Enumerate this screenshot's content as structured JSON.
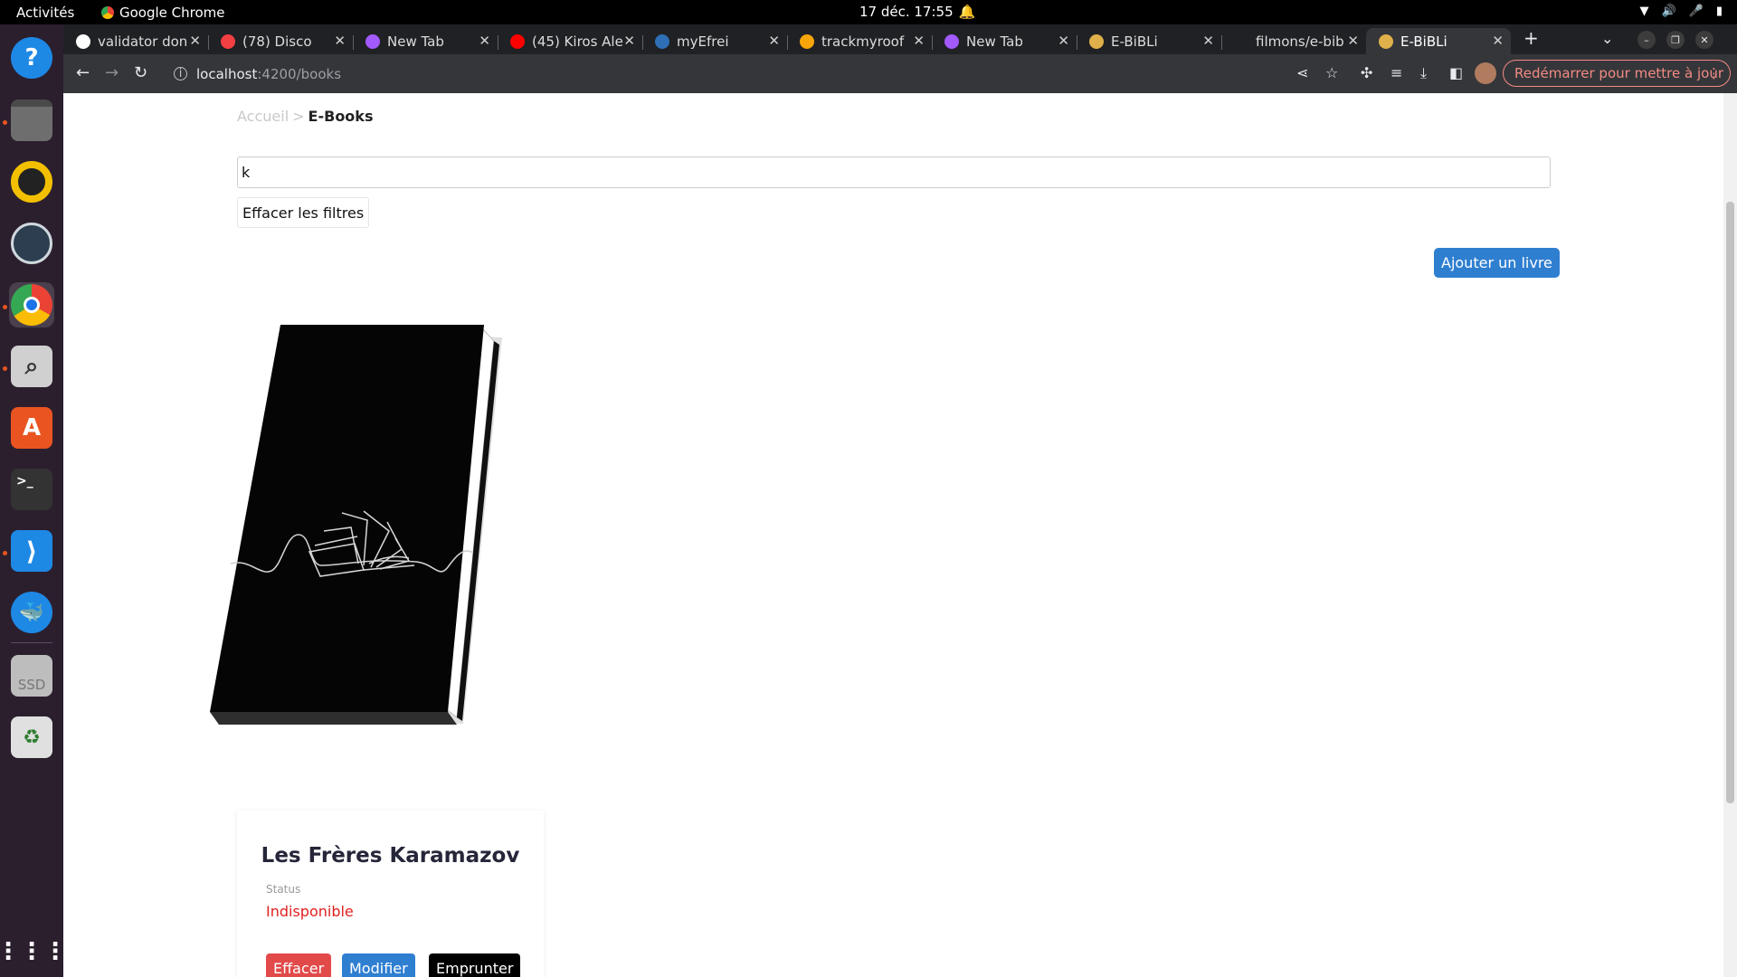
{
  "os": {
    "activities": "Activités",
    "app_name": "Google Chrome",
    "clock": "17 déc.  17:55"
  },
  "dock": {
    "items": [
      "help-icon",
      "files-icon",
      "rhythmbox-icon",
      "stacer-icon",
      "chrome-icon",
      "search-app-icon",
      "app-center-icon",
      "terminal-icon",
      "vscode-icon",
      "docker-icon",
      "ssd-drive-icon",
      "trash-icon",
      "app-grid-icon"
    ],
    "ssd_label": "SSD"
  },
  "browser": {
    "tabs": [
      {
        "title": "validator don",
        "icon": "github-icon",
        "color": "#ffffff"
      },
      {
        "title": "(78) Disco",
        "icon": "discord-icon",
        "color": "#f23f42"
      },
      {
        "title": "New Tab",
        "icon": "newtab-icon",
        "color": "#a25afd"
      },
      {
        "title": "(45) Kiros Ale",
        "icon": "youtube-icon",
        "color": "#ff0000"
      },
      {
        "title": "myEfrei",
        "icon": "efrei-icon",
        "color": "#2e6fb6"
      },
      {
        "title": "trackmyroof",
        "icon": "firebase-icon",
        "color": "#f6a609"
      },
      {
        "title": "New Tab",
        "icon": "newtab-icon",
        "color": "#a25afd"
      },
      {
        "title": "E-BiBLi",
        "icon": "ebibli-icon",
        "color": "#e0b04a"
      },
      {
        "title": "filmons/e-bib",
        "icon": "github-icon",
        "color": "#202124"
      },
      {
        "title": "E-BiBLi",
        "icon": "ebibli-icon",
        "color": "#e0b04a"
      }
    ],
    "active_tab": 9,
    "url_host": "localhost",
    "url_path": ":4200/books",
    "update_label": "Redémarrer pour mettre à jour"
  },
  "page": {
    "breadcrumb_home": "Accueil",
    "breadcrumb_sep": ">",
    "breadcrumb_current": "E-Books",
    "search_value": "k",
    "clear_filters": "Effacer les filtres",
    "add_book": "Ajouter un livre",
    "books": [
      {
        "title": "Les Frères Karamazov",
        "status_label": "Status",
        "status_value": "Indisponible",
        "status_color": "#e02020",
        "delete_label": "Effacer",
        "edit_label": "Modifier",
        "borrow_label": "Emprunter"
      }
    ]
  }
}
